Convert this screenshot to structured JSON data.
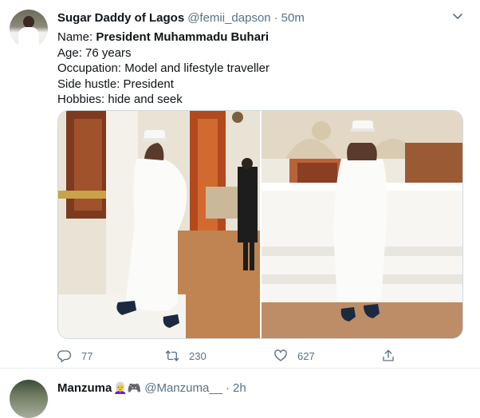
{
  "tweet": {
    "display_name": "Sugar Daddy of Lagos",
    "handle": "@femii_dapson",
    "separator": "·",
    "time": "50m",
    "lines": {
      "name_label": "Name: ",
      "name_value": "President Muhammadu Buhari",
      "age": "Age: 76 years",
      "occupation": "Occupation: Model and lifestyle traveller",
      "side_hustle": "Side hustle: President",
      "hobbies": "Hobbies: hide and seek"
    },
    "counts": {
      "replies": "77",
      "retweets": "230",
      "likes": "627"
    },
    "icons": {
      "menu": "chevron-down-icon",
      "reply": "reply-icon",
      "retweet": "retweet-icon",
      "like": "heart-icon",
      "share": "share-icon"
    }
  },
  "next_tweet": {
    "display_name": "Manzuma",
    "emoji": "👩‍🦳🎮",
    "handle": "@Manzuma__",
    "separator": "·",
    "time": "2h"
  },
  "colors": {
    "secondary_text": "#5b7083",
    "divider": "#e6ecf0"
  }
}
